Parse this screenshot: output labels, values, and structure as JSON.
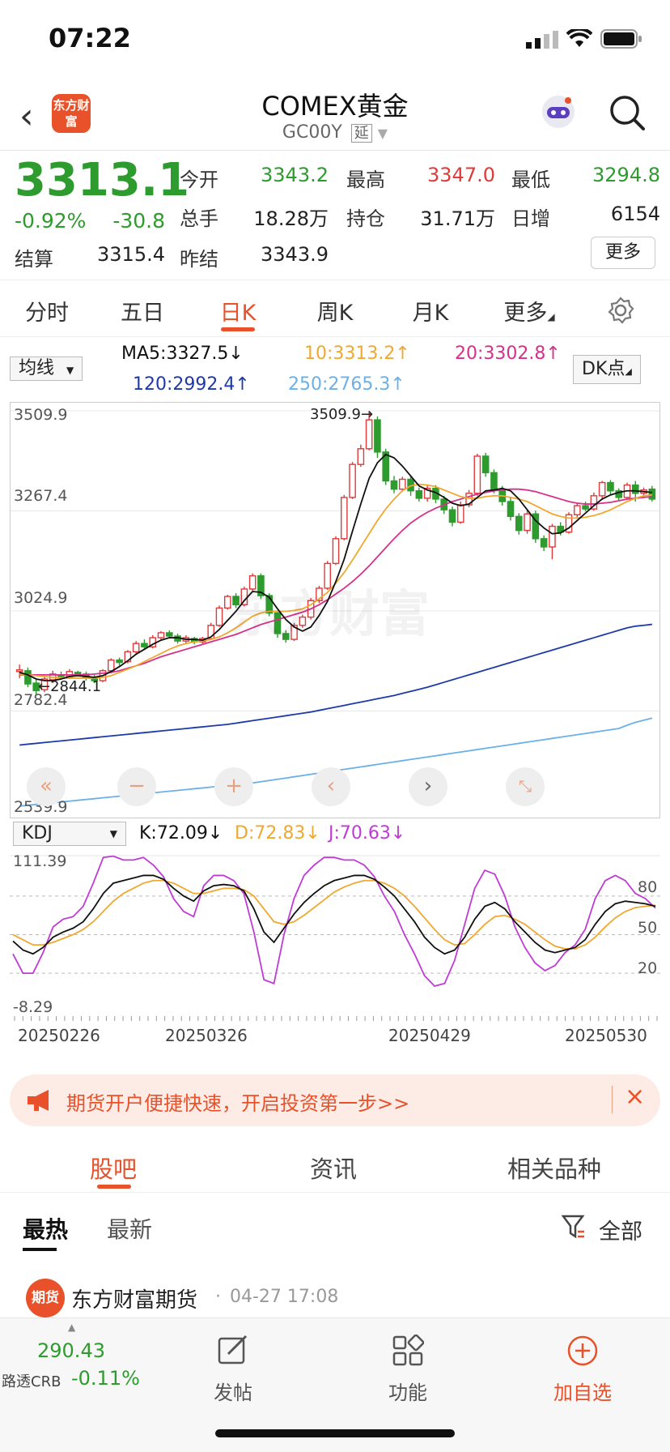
{
  "status_bar": {
    "time": "07:22"
  },
  "header": {
    "logo_text": "东方财富",
    "title": "COMEX黄金",
    "code": "GC00Y",
    "code_badge": "延"
  },
  "quote": {
    "price": "3313.1",
    "change_pct": "-0.92%",
    "change": "-30.8",
    "settle_label": "结算",
    "settle": "3315.4",
    "fields": [
      {
        "label": "今开",
        "value": "3343.2",
        "color": "green"
      },
      {
        "label": "最高",
        "value": "3347.0",
        "color": "red"
      },
      {
        "label": "最低",
        "value": "3294.8",
        "color": "green"
      },
      {
        "label": "总手",
        "value": "18.28万",
        "color": "black"
      },
      {
        "label": "持仓",
        "value": "31.71万",
        "color": "black"
      },
      {
        "label": "日增",
        "value": "6154",
        "color": "black"
      },
      {
        "label": "昨结",
        "value": "3343.9",
        "color": "black"
      }
    ],
    "more_button": "更多"
  },
  "tabs": [
    "分时",
    "五日",
    "日K",
    "周K",
    "月K",
    "更多"
  ],
  "active_tab": "日K",
  "ma": {
    "selector": "均线",
    "ma5": "MA5:3327.5↓",
    "ma10": "10:3313.2↑",
    "ma20": "20:3302.8↑",
    "ma120": "120:2992.4↑",
    "ma250": "250:2765.3↑",
    "dk_button": "DK点",
    "colors": {
      "ma5": "#111111",
      "ma10": "#f0a830",
      "ma20": "#d6308a",
      "ma120": "#1e3aa8",
      "ma250": "#6bb0e8"
    }
  },
  "chart_data": [
    {
      "type": "candlestick",
      "y_ticks": [
        "3509.9",
        "3267.4",
        "3024.9",
        "2782.4",
        "2539.9"
      ],
      "ylim": [
        2539.9,
        3509.9
      ],
      "annotations": [
        "3509.9→",
        "←2844.1"
      ],
      "candles": [
        [
          2878,
          2882,
          2862,
          2895
        ],
        [
          2880,
          2848,
          2840,
          2888
        ],
        [
          2850,
          2832,
          2820,
          2858
        ],
        [
          2834,
          2860,
          2828,
          2866
        ],
        [
          2858,
          2872,
          2850,
          2880
        ],
        [
          2870,
          2866,
          2860,
          2878
        ],
        [
          2866,
          2878,
          2860,
          2884
        ],
        [
          2876,
          2870,
          2866,
          2880
        ],
        [
          2872,
          2862,
          2856,
          2878
        ],
        [
          2864,
          2856,
          2850,
          2870
        ],
        [
          2856,
          2880,
          2852,
          2884
        ],
        [
          2880,
          2906,
          2878,
          2910
        ],
        [
          2906,
          2900,
          2892,
          2912
        ],
        [
          2902,
          2926,
          2898,
          2930
        ],
        [
          2926,
          2946,
          2922,
          2952
        ],
        [
          2946,
          2938,
          2930,
          2956
        ],
        [
          2938,
          2960,
          2934,
          2966
        ],
        [
          2960,
          2972,
          2954,
          2976
        ],
        [
          2972,
          2964,
          2958,
          2978
        ],
        [
          2964,
          2952,
          2946,
          2970
        ],
        [
          2952,
          2960,
          2946,
          2966
        ],
        [
          2958,
          2950,
          2944,
          2962
        ],
        [
          2950,
          2958,
          2946,
          2962
        ],
        [
          2958,
          2990,
          2954,
          2996
        ],
        [
          2990,
          3032,
          2986,
          3038
        ],
        [
          3032,
          3060,
          3028,
          3064
        ],
        [
          3060,
          3040,
          3032,
          3068
        ],
        [
          3040,
          3078,
          3036,
          3084
        ],
        [
          3078,
          3110,
          3074,
          3116
        ],
        [
          3110,
          3062,
          3054,
          3116
        ],
        [
          3062,
          3020,
          3012,
          3068
        ],
        [
          3020,
          2970,
          2960,
          3026
        ],
        [
          2970,
          2956,
          2948,
          2978
        ],
        [
          2956,
          2990,
          2952,
          2996
        ],
        [
          2990,
          3010,
          2984,
          3016
        ],
        [
          3010,
          3050,
          3004,
          3056
        ],
        [
          3050,
          3080,
          3044,
          3086
        ],
        [
          3080,
          3140,
          3076,
          3146
        ],
        [
          3140,
          3200,
          3136,
          3206
        ],
        [
          3200,
          3300,
          3196,
          3306
        ],
        [
          3300,
          3380,
          3296,
          3386
        ],
        [
          3380,
          3418,
          3374,
          3428
        ],
        [
          3418,
          3488,
          3414,
          3509.9
        ],
        [
          3488,
          3410,
          3396,
          3496
        ],
        [
          3410,
          3340,
          3330,
          3418
        ],
        [
          3340,
          3320,
          3310,
          3352
        ],
        [
          3320,
          3344,
          3314,
          3350
        ],
        [
          3344,
          3316,
          3304,
          3352
        ],
        [
          3316,
          3298,
          3290,
          3324
        ],
        [
          3298,
          3322,
          3290,
          3330
        ],
        [
          3322,
          3296,
          3286,
          3330
        ],
        [
          3296,
          3270,
          3260,
          3304
        ],
        [
          3270,
          3240,
          3230,
          3278
        ],
        [
          3240,
          3282,
          3236,
          3290
        ],
        [
          3282,
          3310,
          3276,
          3318
        ],
        [
          3310,
          3400,
          3304,
          3406
        ],
        [
          3400,
          3360,
          3350,
          3408
        ],
        [
          3360,
          3320,
          3310,
          3368
        ],
        [
          3320,
          3290,
          3280,
          3328
        ],
        [
          3290,
          3254,
          3244,
          3300
        ],
        [
          3254,
          3220,
          3210,
          3262
        ],
        [
          3220,
          3260,
          3212,
          3268
        ],
        [
          3260,
          3200,
          3190,
          3268
        ],
        [
          3200,
          3180,
          3170,
          3208
        ],
        [
          3180,
          3230,
          3150,
          3236
        ],
        [
          3230,
          3216,
          3208,
          3240
        ],
        [
          3216,
          3258,
          3212,
          3264
        ],
        [
          3258,
          3280,
          3252,
          3286
        ],
        [
          3280,
          3272,
          3266,
          3290
        ],
        [
          3272,
          3304,
          3268,
          3312
        ],
        [
          3304,
          3336,
          3298,
          3340
        ],
        [
          3336,
          3316,
          3306,
          3342
        ],
        [
          3316,
          3300,
          3294,
          3322
        ],
        [
          3300,
          3330,
          3296,
          3336
        ],
        [
          3330,
          3310,
          3290,
          3340
        ],
        [
          3310,
          3318,
          3300,
          3324
        ],
        [
          3320,
          3296,
          3290,
          3328
        ]
      ],
      "lines": {
        "ma5": [
          2876,
          2870,
          2860,
          2856,
          2856,
          2860,
          2866,
          2868,
          2866,
          2864,
          2868,
          2878,
          2890,
          2904,
          2920,
          2932,
          2944,
          2954,
          2960,
          2960,
          2956,
          2956,
          2954,
          2962,
          2980,
          3002,
          3024,
          3050,
          3072,
          3070,
          3058,
          3030,
          3004,
          2986,
          2976,
          2986,
          3014,
          3048,
          3096,
          3150,
          3218,
          3284,
          3346,
          3384,
          3404,
          3396,
          3376,
          3352,
          3328,
          3318,
          3312,
          3300,
          3286,
          3280,
          3284,
          3300,
          3316,
          3318,
          3322,
          3316,
          3296,
          3270,
          3244,
          3226,
          3212,
          3214,
          3226,
          3244,
          3262,
          3280,
          3296,
          3306,
          3312,
          3316,
          3316,
          3314,
          3312
        ],
        "ma10": [
          2872,
          2870,
          2868,
          2866,
          2864,
          2862,
          2862,
          2862,
          2862,
          2862,
          2864,
          2868,
          2876,
          2884,
          2892,
          2902,
          2912,
          2922,
          2932,
          2940,
          2946,
          2950,
          2952,
          2956,
          2962,
          2972,
          2984,
          2998,
          3012,
          3020,
          3024,
          3024,
          3024,
          3026,
          3030,
          3040,
          3054,
          3070,
          3092,
          3118,
          3148,
          3180,
          3212,
          3244,
          3272,
          3296,
          3316,
          3328,
          3332,
          3330,
          3326,
          3318,
          3310,
          3302,
          3298,
          3298,
          3302,
          3304,
          3304,
          3300,
          3296,
          3290,
          3280,
          3270,
          3260,
          3254,
          3250,
          3250,
          3252,
          3256,
          3262,
          3270,
          3280,
          3290,
          3298,
          3304,
          3306
        ],
        "ma20": [
          2870,
          2870,
          2870,
          2870,
          2870,
          2870,
          2870,
          2870,
          2870,
          2872,
          2874,
          2876,
          2880,
          2886,
          2892,
          2898,
          2906,
          2914,
          2920,
          2926,
          2932,
          2938,
          2944,
          2950,
          2956,
          2962,
          2968,
          2976,
          2984,
          2992,
          2998,
          3004,
          3010,
          3016,
          3022,
          3030,
          3040,
          3052,
          3066,
          3080,
          3096,
          3114,
          3134,
          3156,
          3178,
          3200,
          3220,
          3238,
          3252,
          3264,
          3274,
          3282,
          3290,
          3296,
          3302,
          3308,
          3312,
          3316,
          3318,
          3320,
          3320,
          3318,
          3314,
          3308,
          3302,
          3296,
          3290,
          3286,
          3284,
          3284,
          3286,
          3288,
          3292,
          3296,
          3298,
          3300,
          3302
        ],
        "ma120": [
          2700,
          2702,
          2704,
          2706,
          2708,
          2710,
          2712,
          2714,
          2716,
          2718,
          2720,
          2722,
          2724,
          2726,
          2728,
          2730,
          2732,
          2734,
          2736,
          2738,
          2740,
          2742,
          2744,
          2746,
          2748,
          2750,
          2753,
          2756,
          2759,
          2762,
          2765,
          2768,
          2771,
          2774,
          2777,
          2780,
          2784,
          2788,
          2792,
          2796,
          2800,
          2804,
          2808,
          2812,
          2816,
          2820,
          2825,
          2830,
          2835,
          2840,
          2846,
          2852,
          2858,
          2864,
          2870,
          2876,
          2882,
          2888,
          2894,
          2900,
          2906,
          2912,
          2918,
          2924,
          2930,
          2936,
          2942,
          2948,
          2954,
          2960,
          2966,
          2972,
          2978,
          2984,
          2988,
          2990,
          2992.4
        ],
        "ma250": [
          2552,
          2554,
          2556,
          2558,
          2560,
          2562,
          2564,
          2566,
          2568,
          2570,
          2572,
          2574,
          2576,
          2578,
          2580,
          2582,
          2584,
          2586,
          2588,
          2590,
          2592,
          2594,
          2596,
          2598,
          2600,
          2602,
          2604,
          2606,
          2608,
          2611,
          2614,
          2617,
          2620,
          2623,
          2626,
          2629,
          2632,
          2635,
          2638,
          2641,
          2644,
          2647,
          2650,
          2653,
          2656,
          2659,
          2662,
          2665,
          2668,
          2671,
          2674,
          2677,
          2680,
          2683,
          2686,
          2689,
          2692,
          2695,
          2698,
          2701,
          2704,
          2707,
          2710,
          2713,
          2716,
          2719,
          2722,
          2725,
          2728,
          2731,
          2734,
          2737,
          2740,
          2748,
          2755,
          2760,
          2765.3
        ]
      }
    },
    {
      "type": "line",
      "name": "KDJ",
      "selector": "KDJ",
      "k_label": "K:72.09↓",
      "d_label": "D:72.83↓",
      "j_label": "J:70.63↓",
      "y_top": "111.39",
      "y_bottom": "-8.29",
      "ylim": [
        -8.29,
        111.39
      ],
      "levels": [
        "80",
        "50",
        "20"
      ],
      "x_labels": [
        "20250226",
        "20250326",
        "20250429",
        "20250530"
      ],
      "K": [
        45,
        38,
        35,
        40,
        48,
        52,
        55,
        60,
        70,
        82,
        90,
        92,
        94,
        96,
        96,
        93,
        86,
        80,
        76,
        84,
        88,
        89,
        88,
        84,
        70,
        52,
        44,
        55,
        66,
        75,
        82,
        88,
        92,
        94,
        96,
        96,
        93,
        87,
        80,
        70,
        60,
        48,
        40,
        35,
        38,
        48,
        62,
        72,
        75,
        70,
        60,
        52,
        44,
        38,
        36,
        38,
        40,
        46,
        58,
        68,
        74,
        76,
        75,
        74,
        72
      ],
      "D": [
        50,
        46,
        42,
        42,
        44,
        47,
        50,
        54,
        60,
        68,
        76,
        82,
        86,
        90,
        92,
        92,
        90,
        86,
        82,
        82,
        84,
        86,
        86,
        85,
        80,
        70,
        60,
        58,
        60,
        65,
        71,
        77,
        83,
        87,
        90,
        92,
        92,
        90,
        86,
        80,
        72,
        63,
        54,
        46,
        42,
        43,
        50,
        58,
        64,
        65,
        62,
        58,
        52,
        46,
        41,
        39,
        39,
        42,
        48,
        56,
        63,
        68,
        71,
        72,
        72.83
      ],
      "J": [
        35,
        20,
        20,
        36,
        56,
        62,
        64,
        72,
        90,
        110,
        111,
        108,
        108,
        110,
        104,
        95,
        78,
        68,
        64,
        88,
        96,
        96,
        92,
        82,
        52,
        15,
        12,
        50,
        78,
        96,
        104,
        110,
        110,
        108,
        108,
        104,
        95,
        80,
        68,
        50,
        35,
        18,
        10,
        12,
        30,
        58,
        86,
        100,
        97,
        80,
        56,
        40,
        28,
        22,
        26,
        36,
        42,
        54,
        78,
        92,
        96,
        92,
        82,
        78,
        70.63
      ]
    }
  ],
  "watermark": "东方财富",
  "banner": {
    "text": "期货开户便捷快速，开启投资第一步>>"
  },
  "section_tabs": [
    "股吧",
    "资讯",
    "相关品种"
  ],
  "active_section": "股吧",
  "feed_tabs": {
    "hot": "最热",
    "latest": "最新",
    "filter": "全部"
  },
  "post": {
    "avatar_text": "期货",
    "author": "东方财富期货",
    "time": "04-27 17:08"
  },
  "bottom_bar": {
    "index_value": "290.43",
    "index_name": "路透CRB",
    "index_change": "-0.11%",
    "post_label": "发帖",
    "func_label": "功能",
    "watch_label": "加自选"
  }
}
